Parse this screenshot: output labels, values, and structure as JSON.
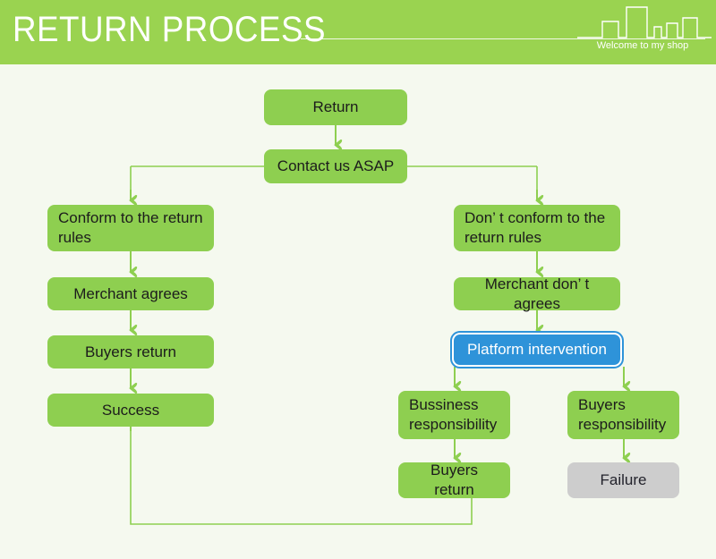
{
  "header": {
    "title": "RETURN PROCESS",
    "tagline": "Welcome to my shop",
    "icon": "city-skyline-icon",
    "bg_color": "#9ad350",
    "text_color": "#ffffff"
  },
  "theme": {
    "page_bg": "#f5f9ef",
    "node_green": "#8ecf50",
    "node_gray": "#cdcdcd",
    "node_blue": "#2e93d9",
    "connector_green": "#8ecf50",
    "text_dark": "#1c1c1c"
  },
  "flow": {
    "nodes": {
      "return": "Return",
      "contact": "Contact us ASAP",
      "conform": "Conform to the return rules",
      "merchant_agrees": "Merchant agrees",
      "buyers_return_left": "Buyers return",
      "success": "Success",
      "not_conform": "Don’ t conform to the return rules",
      "merchant_not_agrees": "Merchant don’ t agrees",
      "platform": "Platform intervention",
      "business_resp": "Bussiness responsibility",
      "buyers_return_right": "Buyers return",
      "buyers_resp": "Buyers responsibility",
      "failure": "Failure"
    }
  }
}
